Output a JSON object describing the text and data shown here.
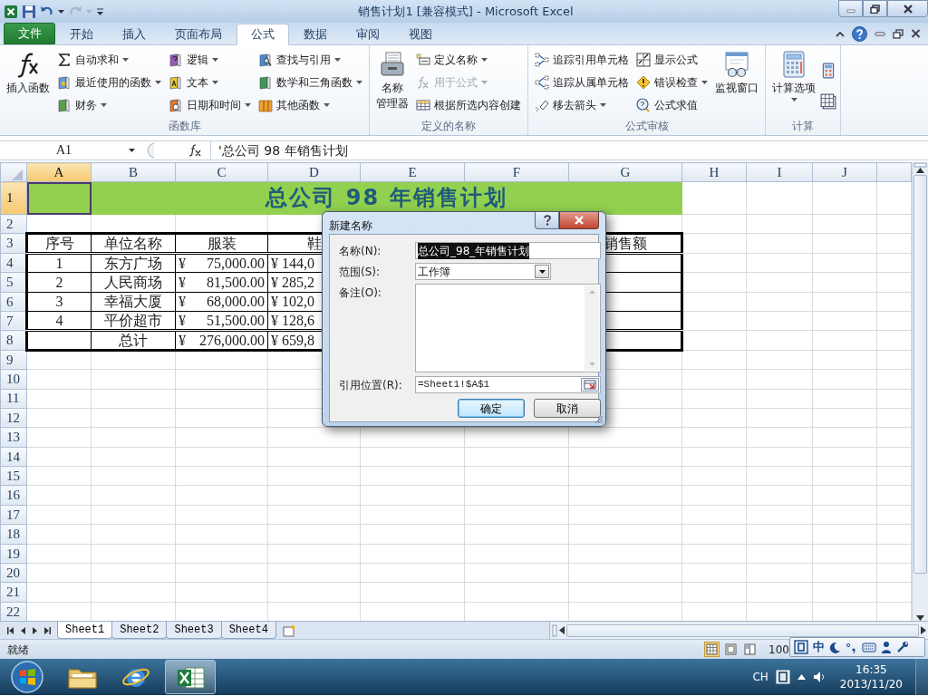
{
  "title_bar": {
    "title": "销售计划1 [兼容模式] - Microsoft Excel"
  },
  "ribbon": {
    "file_tab": "文件",
    "tabs": [
      {
        "label": "开始",
        "selected": false
      },
      {
        "label": "插入",
        "selected": false
      },
      {
        "label": "页面布局",
        "selected": false
      },
      {
        "label": "公式",
        "selected": true
      },
      {
        "label": "数据",
        "selected": false
      },
      {
        "label": "审阅",
        "selected": false
      },
      {
        "label": "视图",
        "selected": false
      }
    ],
    "groups": [
      {
        "label": "函数库",
        "items": [
          {
            "kind": "large",
            "lines": [
              "插入函数"
            ],
            "dropdown": false
          },
          {
            "kind": "small",
            "label": "自动求和",
            "dropdown": true
          },
          {
            "kind": "small",
            "label": "最近使用的函数",
            "dropdown": true
          },
          {
            "kind": "small",
            "label": "财务",
            "dropdown": true
          },
          {
            "kind": "small",
            "label": "逻辑",
            "dropdown": true
          },
          {
            "kind": "small",
            "label": "文本",
            "dropdown": true
          },
          {
            "kind": "small",
            "label": "日期和时间",
            "dropdown": true
          },
          {
            "kind": "small",
            "label": "查找与引用",
            "dropdown": true
          },
          {
            "kind": "small",
            "label": "数学和三角函数",
            "dropdown": true
          },
          {
            "kind": "small",
            "label": "其他函数",
            "dropdown": true
          }
        ]
      },
      {
        "label": "定义的名称",
        "items": [
          {
            "kind": "large",
            "lines": [
              "名称",
              "管理器"
            ],
            "dropdown": false,
            "disabled": false
          },
          {
            "kind": "small",
            "label": "定义名称",
            "dropdown": true,
            "disabled": false
          },
          {
            "kind": "small",
            "label": "用于公式",
            "dropdown": true,
            "disabled": true
          },
          {
            "kind": "small",
            "label": "根据所选内容创建",
            "dropdown": false,
            "disabled": false
          }
        ]
      },
      {
        "label": "公式审核",
        "items": [
          {
            "kind": "small",
            "label": "追踪引用单元格",
            "dropdown": false
          },
          {
            "kind": "small",
            "label": "追踪从属单元格",
            "dropdown": false
          },
          {
            "kind": "small",
            "label": "移去箭头",
            "dropdown": true
          },
          {
            "kind": "small",
            "label": "显示公式",
            "dropdown": false
          },
          {
            "kind": "small",
            "label": "错误检查",
            "dropdown": true
          },
          {
            "kind": "small",
            "label": "公式求值",
            "dropdown": false
          },
          {
            "kind": "large",
            "lines": [
              "监视窗口"
            ],
            "dropdown": false
          }
        ]
      },
      {
        "label": "计算",
        "items": [
          {
            "kind": "large",
            "lines": [
              "计算选项"
            ],
            "dropdown": true
          },
          {
            "kind": "icon"
          },
          {
            "kind": "icon"
          }
        ]
      }
    ]
  },
  "formula_bar": {
    "name_box": "A1",
    "formula": "'总公司 98 年销售计划"
  },
  "sheet": {
    "columns": [
      {
        "label": "A",
        "selected": true
      },
      {
        "label": "B",
        "selected": false
      },
      {
        "label": "C",
        "selected": false
      },
      {
        "label": "D",
        "selected": false
      },
      {
        "label": "E",
        "selected": false
      },
      {
        "label": "F",
        "selected": false
      },
      {
        "label": "G",
        "selected": false
      },
      {
        "label": "H",
        "selected": false
      },
      {
        "label": "I",
        "selected": false
      },
      {
        "label": "J",
        "selected": false
      }
    ],
    "rows": [
      {
        "label": "1",
        "selected": true,
        "kind": "title",
        "cells": [
          {
            "kind": "empty"
          },
          {
            "kind": "merged",
            "text": "总公司 98 年销售计划"
          }
        ]
      },
      {
        "label": "2",
        "selected": false
      },
      {
        "label": "3",
        "selected": false,
        "kind": "header",
        "cells": [
          {
            "kind": "text",
            "text": "序号"
          },
          {
            "kind": "text",
            "text": "单位名称"
          },
          {
            "kind": "text",
            "text": "服装"
          },
          {
            "kind": "text",
            "text": "鞋"
          },
          {
            "kind": "empty"
          },
          {
            "kind": "empty"
          },
          {
            "kind": "text",
            "text": "销售额"
          }
        ]
      },
      {
        "label": "4",
        "selected": false,
        "kind": "data",
        "cells": [
          {
            "kind": "text",
            "text": "1"
          },
          {
            "kind": "text",
            "text": "东方广场"
          },
          {
            "kind": "currency",
            "text": "¥ 75,000.00"
          },
          {
            "kind": "cut",
            "text": "¥ 144,0"
          }
        ]
      },
      {
        "label": "5",
        "selected": false,
        "kind": "data",
        "cells": [
          {
            "kind": "text",
            "text": "2"
          },
          {
            "kind": "text",
            "text": "人民商场"
          },
          {
            "kind": "currency",
            "text": "¥ 81,500.00"
          },
          {
            "kind": "cut",
            "text": "¥ 285,2"
          }
        ]
      },
      {
        "label": "6",
        "selected": false,
        "kind": "data",
        "cells": [
          {
            "kind": "text",
            "text": "3"
          },
          {
            "kind": "text",
            "text": "幸福大厦"
          },
          {
            "kind": "currency",
            "text": "¥ 68,000.00"
          },
          {
            "kind": "cut",
            "text": "¥ 102,0"
          }
        ]
      },
      {
        "label": "7",
        "selected": false,
        "kind": "data",
        "cells": [
          {
            "kind": "text",
            "text": "4"
          },
          {
            "kind": "text",
            "text": "平价超市"
          },
          {
            "kind": "currency",
            "text": "¥ 51,500.00"
          },
          {
            "kind": "cut",
            "text": "¥ 128,6"
          }
        ]
      },
      {
        "label": "8",
        "selected": false,
        "kind": "total",
        "cells": [
          {
            "kind": "empty"
          },
          {
            "kind": "text",
            "text": "总计"
          },
          {
            "kind": "currency",
            "text": "¥ 276,000.00"
          },
          {
            "kind": "cut",
            "text": "¥ 659,8"
          }
        ]
      },
      {
        "label": "9",
        "selected": false
      },
      {
        "label": "10",
        "selected": false
      },
      {
        "label": "11",
        "selected": false
      },
      {
        "label": "12",
        "selected": false
      },
      {
        "label": "13",
        "selected": false
      },
      {
        "label": "14",
        "selected": false
      },
      {
        "label": "15",
        "selected": false
      },
      {
        "label": "16",
        "selected": false
      },
      {
        "label": "17",
        "selected": false
      },
      {
        "label": "18",
        "selected": false
      },
      {
        "label": "19",
        "selected": false
      },
      {
        "label": "20",
        "selected": false
      },
      {
        "label": "21",
        "selected": false
      },
      {
        "label": "22",
        "selected": false
      }
    ]
  },
  "dialog": {
    "title": "新建名称",
    "fields": [
      {
        "kind": "text",
        "label": "名称(N):",
        "value": "总公司_98_年销售计划",
        "highlighted": true
      },
      {
        "kind": "select",
        "label": "范围(S):",
        "value": "工作簿"
      },
      {
        "kind": "textarea",
        "label": "备注(O):"
      },
      {
        "kind": "reference",
        "label": "引用位置(R):",
        "value": "=Sheet1!$A$1"
      }
    ],
    "buttons": [
      {
        "label": "确定",
        "default": true
      },
      {
        "label": "取消",
        "default": false
      }
    ]
  },
  "sheet_tabs": [
    {
      "label": "Sheet1",
      "selected": true
    },
    {
      "label": "Sheet2",
      "selected": false
    },
    {
      "label": "Sheet3",
      "selected": false
    },
    {
      "label": "Sheet4",
      "selected": false
    }
  ],
  "status_bar": {
    "text": "就绪",
    "views": [
      {
        "selected": true
      },
      {
        "selected": false
      },
      {
        "selected": false
      }
    ],
    "zoom": "100"
  },
  "ime_bar": {
    "mode": "中"
  },
  "taskbar": {
    "apps": [
      {
        "selected": false
      },
      {
        "selected": false
      },
      {
        "selected": true
      }
    ],
    "language": "CH",
    "time": "16:35",
    "date": "2013/11/20"
  }
}
